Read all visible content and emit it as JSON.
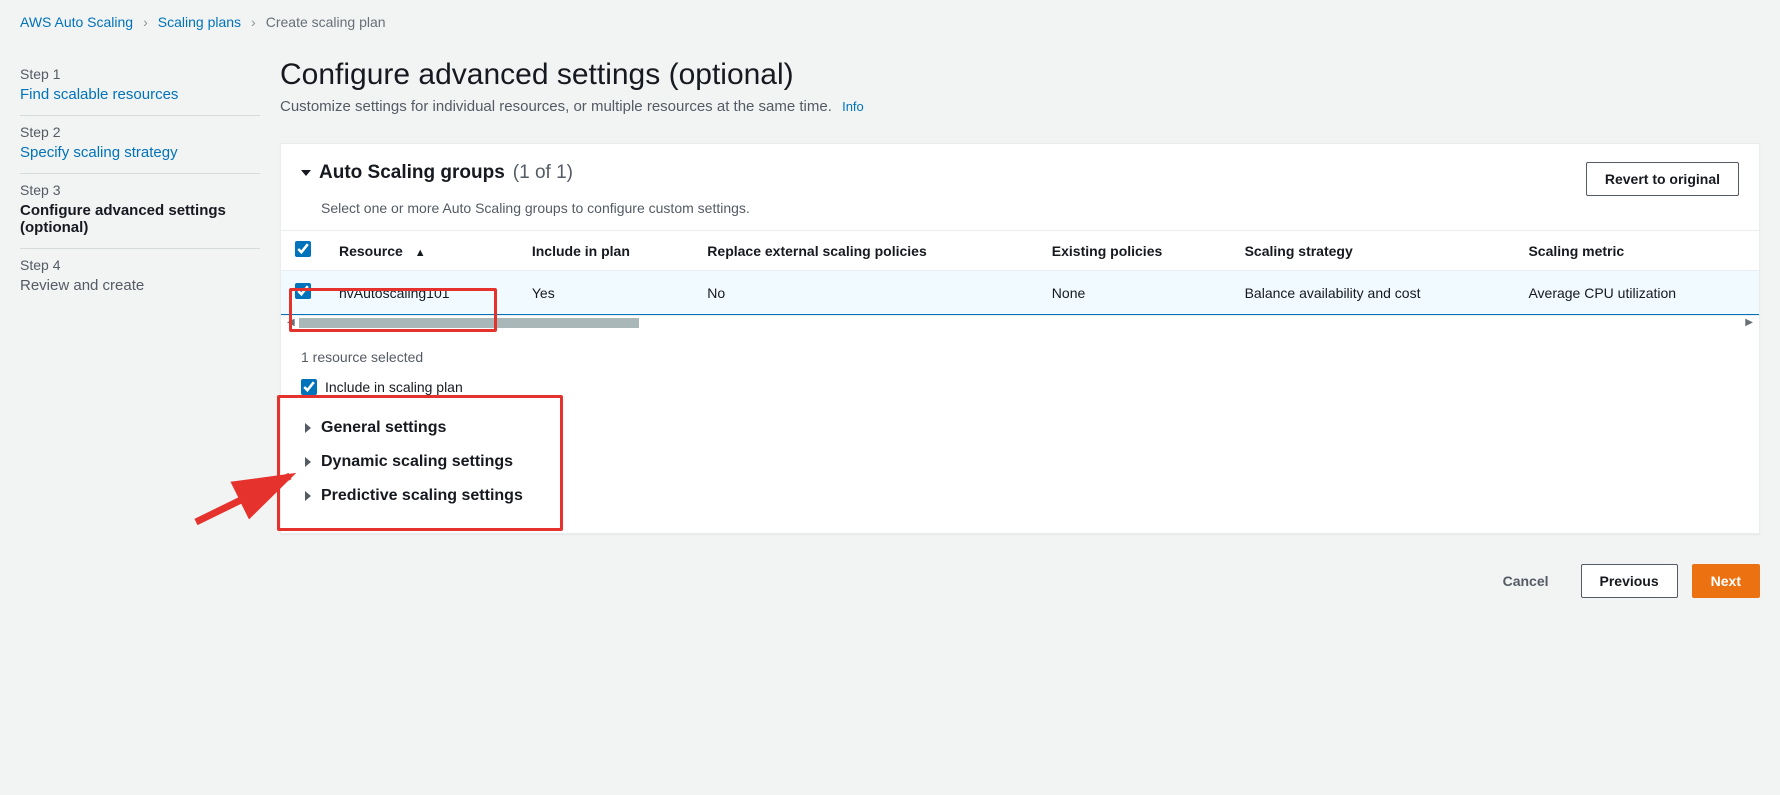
{
  "breadcrumb": {
    "root": "AWS Auto Scaling",
    "parent": "Scaling plans",
    "current": "Create scaling plan"
  },
  "steps": [
    {
      "label": "Step 1",
      "title": "Find scalable resources",
      "state": "link"
    },
    {
      "label": "Step 2",
      "title": "Specify scaling strategy",
      "state": "link"
    },
    {
      "label": "Step 3",
      "title": "Configure advanced settings (optional)",
      "state": "active"
    },
    {
      "label": "Step 4",
      "title": "Review and create",
      "state": "pending"
    }
  ],
  "page": {
    "title": "Configure advanced settings (optional)",
    "subtitle": "Customize settings for individual resources, or multiple resources at the same time.",
    "info": "Info"
  },
  "groupPanel": {
    "title": "Auto Scaling groups",
    "count": "(1 of 1)",
    "description": "Select one or more Auto Scaling groups to configure custom settings.",
    "revert_label": "Revert to original"
  },
  "table": {
    "headers": {
      "resource": "Resource",
      "include": "Include in plan",
      "replace": "Replace external scaling policies",
      "existing": "Existing policies",
      "strategy": "Scaling strategy",
      "metric": "Scaling metric"
    },
    "rows": [
      {
        "resource": "hvAutoscaling101",
        "include": "Yes",
        "replace": "No",
        "existing": "None",
        "strategy": "Balance availability and cost",
        "metric": "Average CPU utilization",
        "selected": true
      }
    ]
  },
  "selection": {
    "count_text": "1 resource selected",
    "include_label": "Include in scaling plan",
    "expanders": [
      "General settings",
      "Dynamic scaling settings",
      "Predictive scaling settings"
    ]
  },
  "footer": {
    "cancel": "Cancel",
    "previous": "Previous",
    "next": "Next"
  }
}
